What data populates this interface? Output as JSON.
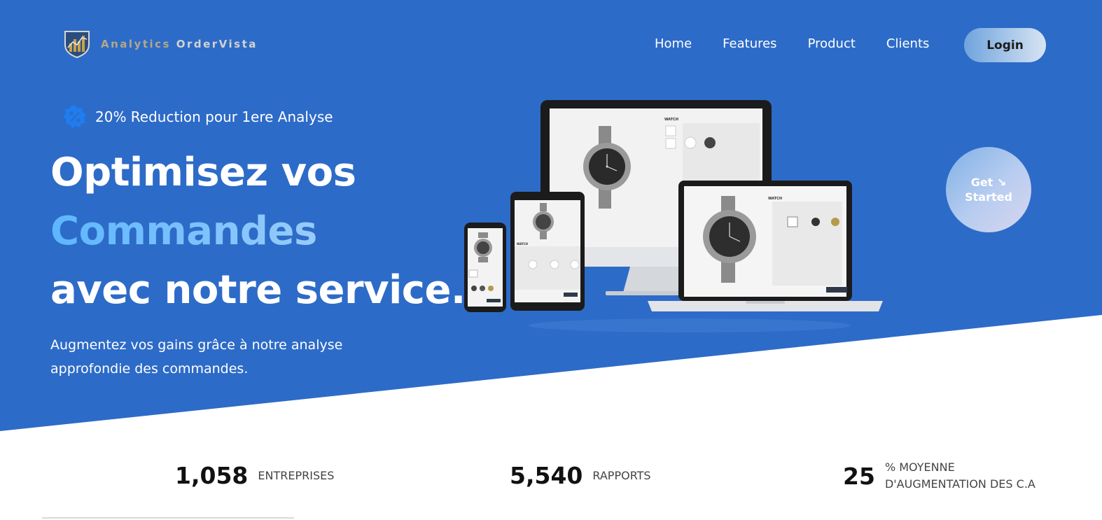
{
  "brand": {
    "name_part1": "Analytics",
    "name_part2": "OrderVista",
    "logo_icon": "shield-bar-chart-icon"
  },
  "nav": {
    "items": [
      {
        "label": "Home"
      },
      {
        "label": "Features"
      },
      {
        "label": "Product"
      },
      {
        "label": "Clients"
      }
    ],
    "login_label": "Login"
  },
  "promo": {
    "icon": "percent-badge-icon",
    "text": "20% Reduction pour 1ere Analyse"
  },
  "hero": {
    "line1": "Optimisez vos",
    "line2": "Commandes",
    "line3": "avec notre service.",
    "subtitle": "Augmentez vos gains grâce à notre analyse approfondie des commandes.",
    "image": "devices-mockup-watch-shop"
  },
  "devices_screen": {
    "title": "WATCH"
  },
  "cta": {
    "line1": "Get ↘",
    "line2": "Started"
  },
  "stats": [
    {
      "value": "1,058",
      "label": "ENTREPRISES"
    },
    {
      "value": "5,540",
      "label": "RAPPORTS"
    },
    {
      "value": "25",
      "label_line1": "% MOYENNE",
      "label_line2": "D'AUGMENTATION DES C.A"
    }
  ],
  "colors": {
    "hero_blue": "#2d6bc8",
    "accent_light_blue": "#5cb6ff",
    "white": "#ffffff",
    "text_dark": "#111111"
  }
}
